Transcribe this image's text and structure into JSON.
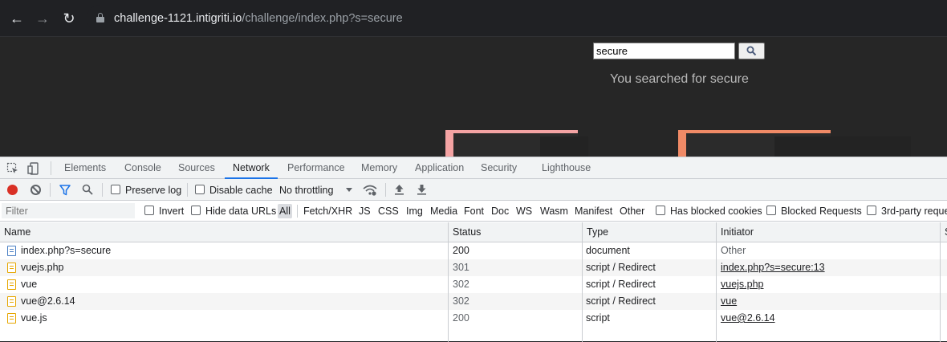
{
  "browser": {
    "url_host": "challenge-1121.intigriti.io",
    "url_path": "/challenge/index.php?s=secure"
  },
  "page": {
    "search_value": "secure",
    "search_button_icon": "magnifier-icon",
    "searched_text": "You searched for secure"
  },
  "devtools": {
    "tabs": [
      "Elements",
      "Console",
      "Sources",
      "Network",
      "Performance",
      "Memory",
      "Application",
      "Security",
      "Lighthouse"
    ],
    "active_tab": "Network",
    "toolbar": {
      "preserve_log": "Preserve log",
      "disable_cache": "Disable cache",
      "throttling": "No throttling"
    },
    "filterbar": {
      "filter_placeholder": "Filter",
      "invert": "Invert",
      "hide_data_urls": "Hide data URLs",
      "types": [
        "All",
        "Fetch/XHR",
        "JS",
        "CSS",
        "Img",
        "Media",
        "Font",
        "Doc",
        "WS",
        "Wasm",
        "Manifest",
        "Other"
      ],
      "has_blocked_cookies": "Has blocked cookies",
      "blocked_requests": "Blocked Requests",
      "third_party": "3rd-party reque"
    },
    "table": {
      "headers": [
        "Name",
        "Status",
        "Type",
        "Initiator",
        "S"
      ],
      "rows": [
        {
          "name": "index.php?s=secure",
          "status": "200",
          "type": "document",
          "initiator": "Other",
          "icon": "document-icon"
        },
        {
          "name": "vuejs.php",
          "status": "301",
          "type": "script / Redirect",
          "initiator": "index.php?s=secure:13",
          "icon": "script-icon"
        },
        {
          "name": "vue",
          "status": "302",
          "type": "script / Redirect",
          "initiator": "vuejs.php",
          "icon": "script-icon"
        },
        {
          "name": "vue@2.6.14",
          "status": "302",
          "type": "script / Redirect",
          "initiator": "vue",
          "icon": "script-icon"
        },
        {
          "name": "vue.js",
          "status": "200",
          "type": "script",
          "initiator": "vue@2.6.14",
          "icon": "script-icon"
        }
      ]
    },
    "colors": {
      "record": "#d93025",
      "active_tab_underline": "#1a73e8",
      "script_icon": "#e6a600",
      "document_icon": "#4a7fc4"
    }
  }
}
